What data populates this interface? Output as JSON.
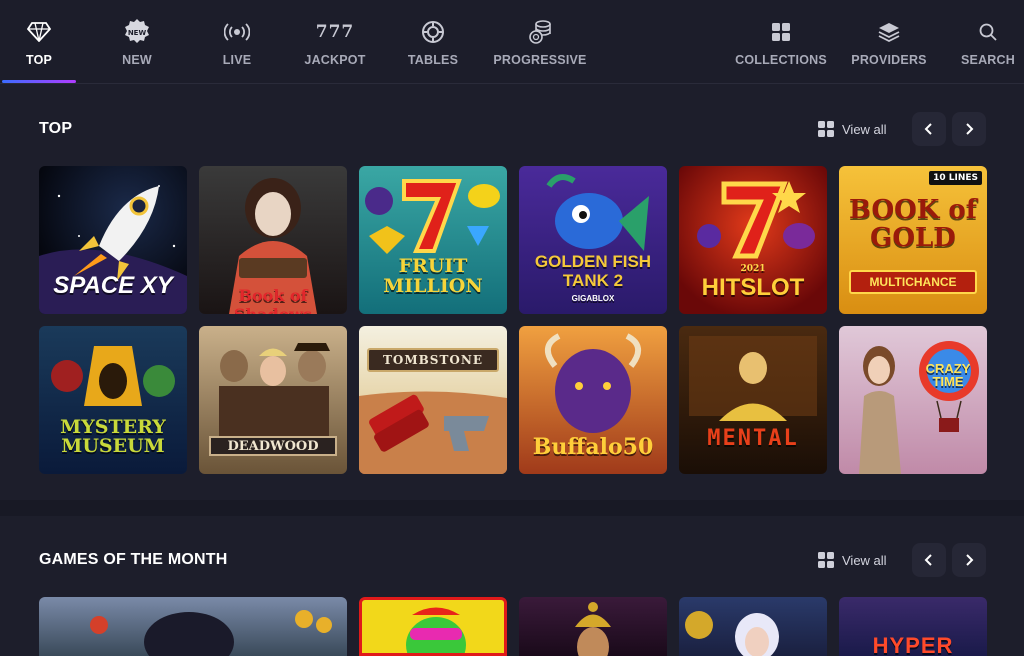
{
  "nav": {
    "items": [
      {
        "label": "TOP",
        "icon": "diamond-icon"
      },
      {
        "label": "NEW",
        "icon": "new-badge-icon",
        "badge": "NEW"
      },
      {
        "label": "LIVE",
        "icon": "broadcast-icon"
      },
      {
        "label": "JACKPOT",
        "icon": "sevens-icon",
        "glyph": "777"
      },
      {
        "label": "TABLES",
        "icon": "chip-icon"
      },
      {
        "label": "PROGRESSIVE",
        "icon": "coins-stack-icon"
      },
      {
        "label": "COLLECTIONS",
        "icon": "grid-icon"
      },
      {
        "label": "PROVIDERS",
        "icon": "layers-icon"
      },
      {
        "label": "SEARCH",
        "icon": "search-icon"
      }
    ],
    "active": "TOP"
  },
  "sections": [
    {
      "title": "TOP",
      "view_all": "View all",
      "games": [
        {
          "title": "SPACE XY",
          "icon": "rocket-icon"
        },
        {
          "title": "Book of Shadows"
        },
        {
          "title": "FRUIT MILLION"
        },
        {
          "title": "GOLDEN FISH TANK 2",
          "subtitle": "GIGABLOX"
        },
        {
          "title": "HITSLOT",
          "subtitle": "2021"
        },
        {
          "title": "BOOK of GOLD",
          "subtitle": "MULTICHANCE",
          "badge": "10 LINES"
        },
        {
          "title": "MYSTERY MUSEUM"
        },
        {
          "title": "DEADWOOD"
        },
        {
          "title": "TOMBSTONE"
        },
        {
          "title": "Buffalo50"
        },
        {
          "title": "MENTAL"
        },
        {
          "title": "CRAZY TIME"
        }
      ]
    },
    {
      "title": "GAMES OF THE MONTH",
      "view_all": "View all",
      "games": [
        {
          "title": ""
        },
        {
          "title": ""
        },
        {
          "title": ""
        },
        {
          "title": ""
        },
        {
          "title": "HYPER"
        }
      ]
    }
  ],
  "colors": {
    "background": "#1d1e2b",
    "nav_active_gradient_start": "#3b6cff",
    "nav_active_gradient_end": "#b13cff",
    "muted_text": "#a8aab8"
  }
}
